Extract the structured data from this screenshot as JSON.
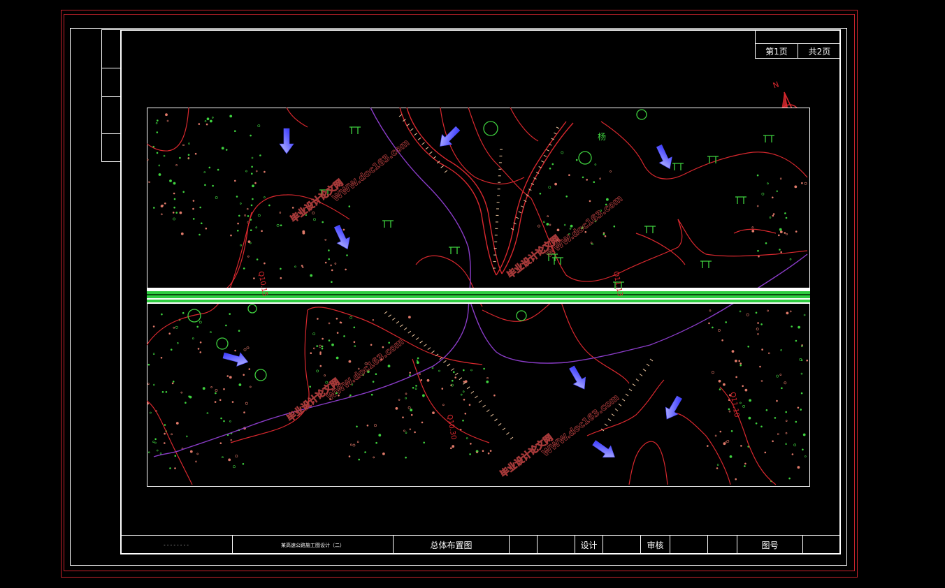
{
  "page_box": {
    "page_no": "第1页",
    "page_total": "共2页"
  },
  "title_block": {
    "school": "- - -  - -   - - -",
    "project": "某高速公路施工图设计（二）",
    "drawing_title": "总体布置图",
    "design_label": "设计",
    "review_label": "审核",
    "drawing_no_label": "图号"
  },
  "map": {
    "elevation_labels": [
      "Q10.15",
      "Q11.13",
      "Q10.30",
      "Q11.10"
    ],
    "place_label": "杨",
    "north_label": "N",
    "watermark_a": "毕业设计论文网",
    "watermark_b": "WWW.doc163.com"
  },
  "colors": {
    "frame_red": "#c8232c",
    "contour_red": "#d8282e",
    "road_green": "#2ecc40",
    "creek_purple": "#8a3cc8",
    "symbol_green": "#3fd23f",
    "arrow_blue": "#3b3bff",
    "watermark": "#b84040"
  }
}
